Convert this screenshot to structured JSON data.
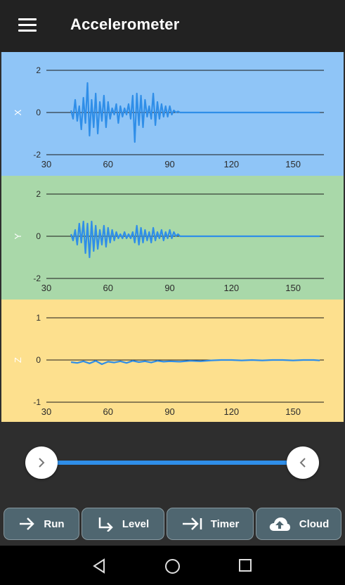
{
  "app": {
    "title": "Accelerometer"
  },
  "icons": {
    "menu": "hamburger-menu-icon",
    "slider_left": "chevron-right-icon",
    "slider_right": "chevron-left-icon",
    "run": "arrow-right-icon",
    "level": "arrow-down-right-icon",
    "timer": "arrow-to-bar-icon",
    "cloud": "cloud-upload-icon",
    "back": "triangle-back-icon",
    "home": "circle-home-icon",
    "recents": "square-recents-icon"
  },
  "colors": {
    "x_panel": "#8fc5f7",
    "y_panel": "#a9d8a9",
    "z_panel": "#fde08e",
    "signal": "#2f8ee8",
    "button_bg": "#4f6670"
  },
  "buttons": {
    "run": "Run",
    "level": "Level",
    "timer": "Timer",
    "cloud": "Cloud"
  },
  "slider": {
    "start_fraction": 0.0,
    "end_fraction": 1.0
  },
  "chart_data": [
    {
      "type": "line",
      "title": "",
      "ylabel": "X",
      "xlabel": "",
      "xlim": [
        30,
        165
      ],
      "ylim": [
        -2,
        2
      ],
      "x_ticks": [
        "30",
        "60",
        "90",
        "120",
        "150"
      ],
      "y_ticks": [
        "2",
        "0",
        "-2"
      ],
      "grid": "horizontal lines at y ticks",
      "series": [
        {
          "x": [
            42,
            43,
            44,
            45,
            46,
            47,
            48,
            49,
            50,
            51,
            52,
            53,
            54,
            55,
            56,
            57,
            58,
            59,
            60,
            61,
            62,
            63,
            64,
            65,
            66,
            67,
            68,
            69,
            70,
            71,
            72,
            73,
            74,
            75,
            76,
            77,
            78,
            79,
            80,
            81,
            82,
            83,
            84,
            85,
            86,
            87,
            88,
            89,
            90,
            91,
            92,
            93,
            94,
            95,
            96,
            97,
            100,
            110,
            120,
            130,
            140,
            150,
            160,
            163
          ],
          "y": [
            0.1,
            -0.3,
            0.6,
            -0.4,
            0.3,
            -0.8,
            0.7,
            -0.5,
            1.4,
            -1.1,
            0.6,
            -0.7,
            0.9,
            -1.0,
            0.5,
            -0.4,
            0.8,
            -0.7,
            0.5,
            -0.3,
            0.2,
            -0.1,
            0.4,
            -0.5,
            0.3,
            -0.2,
            0.2,
            -0.1,
            0.4,
            -0.3,
            0.8,
            -1.4,
            0.9,
            -0.6,
            0.8,
            -0.7,
            0.6,
            -0.2,
            0.3,
            -0.3,
            0.9,
            -0.6,
            0.5,
            -0.3,
            0.4,
            -0.2,
            0.3,
            -0.2,
            0.3,
            -0.1,
            0.1,
            0.0,
            0.05,
            0.0,
            0.0,
            0.0,
            0.0,
            0.0,
            0.0,
            0.0,
            0.0,
            0.0,
            0.0,
            0.0
          ]
        }
      ]
    },
    {
      "type": "line",
      "title": "",
      "ylabel": "Y",
      "xlabel": "",
      "xlim": [
        30,
        165
      ],
      "ylim": [
        -2,
        2
      ],
      "x_ticks": [
        "30",
        "60",
        "90",
        "120",
        "150"
      ],
      "y_ticks": [
        "2",
        "0",
        "-2"
      ],
      "grid": "horizontal lines at y ticks",
      "series": [
        {
          "x": [
            42,
            43,
            44,
            45,
            46,
            47,
            48,
            49,
            50,
            51,
            52,
            53,
            54,
            55,
            56,
            57,
            58,
            59,
            60,
            61,
            62,
            63,
            64,
            65,
            66,
            67,
            68,
            69,
            70,
            71,
            72,
            73,
            74,
            75,
            76,
            77,
            78,
            79,
            80,
            81,
            82,
            83,
            84,
            85,
            86,
            87,
            88,
            89,
            90,
            91,
            92,
            93,
            94,
            95,
            96,
            97,
            100,
            110,
            120,
            130,
            140,
            150,
            160,
            163
          ],
          "y": [
            0.1,
            -0.2,
            0.3,
            -0.4,
            0.6,
            -0.3,
            0.7,
            -0.8,
            0.6,
            -1.0,
            0.7,
            -0.7,
            0.5,
            -0.6,
            0.3,
            -0.4,
            0.5,
            -0.5,
            0.4,
            -0.3,
            0.3,
            -0.2,
            0.2,
            -0.1,
            0.1,
            -0.1,
            0.2,
            -0.1,
            0.1,
            -0.1,
            0.2,
            -0.3,
            0.5,
            -0.4,
            0.4,
            -0.3,
            0.3,
            -0.2,
            0.2,
            -0.3,
            0.4,
            -0.2,
            0.2,
            -0.1,
            0.3,
            -0.2,
            0.2,
            -0.1,
            0.3,
            -0.1,
            0.2,
            0.0,
            0.1,
            0.0,
            0.0,
            0.0,
            0.0,
            0.0,
            0.0,
            0.0,
            0.0,
            0.0,
            0.0,
            0.0
          ]
        }
      ]
    },
    {
      "type": "line",
      "title": "",
      "ylabel": "Z",
      "xlabel": "",
      "xlim": [
        30,
        165
      ],
      "ylim": [
        -1,
        1
      ],
      "x_ticks": [
        "30",
        "60",
        "90",
        "120",
        "150"
      ],
      "y_ticks": [
        "1",
        "0",
        "-1"
      ],
      "grid": "horizontal lines at y ticks",
      "series": [
        {
          "x": [
            42,
            45,
            48,
            51,
            54,
            57,
            60,
            63,
            66,
            69,
            72,
            75,
            78,
            81,
            84,
            87,
            90,
            95,
            100,
            105,
            110,
            115,
            120,
            125,
            130,
            135,
            140,
            145,
            150,
            155,
            160,
            163
          ],
          "y": [
            -0.05,
            -0.07,
            -0.03,
            -0.08,
            -0.02,
            -0.1,
            -0.04,
            -0.06,
            -0.03,
            -0.07,
            -0.02,
            -0.05,
            -0.03,
            -0.06,
            -0.02,
            -0.04,
            -0.03,
            -0.04,
            -0.02,
            -0.03,
            -0.01,
            0.0,
            0.0,
            -0.01,
            0.0,
            -0.01,
            0.0,
            0.0,
            -0.01,
            0.0,
            0.0,
            -0.01
          ]
        }
      ]
    }
  ]
}
